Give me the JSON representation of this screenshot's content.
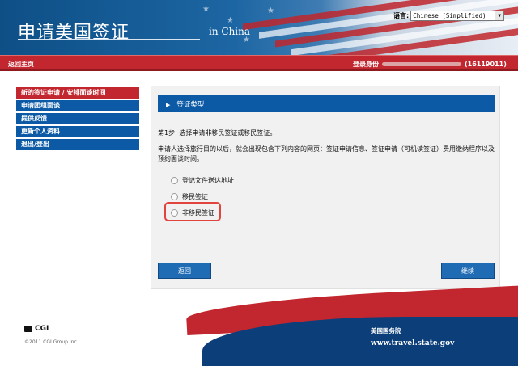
{
  "header": {
    "title": "申请美国签证",
    "subtitle": "in China",
    "language_label": "语言:",
    "language_value": "Chinese (Simplified)"
  },
  "nav": {
    "home": "返回主页",
    "login_label": "登录身份",
    "login_id": "(16119011)"
  },
  "sidebar": {
    "items": [
      {
        "label": "新的签证申请 / 安排面谈时间",
        "active": true
      },
      {
        "label": "申请团组面谈",
        "active": false
      },
      {
        "label": "提供反馈",
        "active": false
      },
      {
        "label": "更新个人资料",
        "active": false
      },
      {
        "label": "退出/登出",
        "active": false
      }
    ]
  },
  "panel": {
    "header": "签证类型",
    "step": "第1步: 选择申请非移民签证或移民签证。",
    "description": "申请人选择旅行目的以后，就会出现包含下列内容的网页：签证申请信息、签证申请（可机读签证）费用缴纳程序以及预约面谈时间。",
    "options": [
      {
        "label": "登记文件送达地址"
      },
      {
        "label": "移民签证"
      },
      {
        "label": "非移民签证"
      }
    ],
    "back_label": "返回",
    "next_label": "继续"
  },
  "footer": {
    "brand": "CGI",
    "copyright": "©2011 CGI Group Inc.",
    "department": "美国国务院",
    "site": "www.travel.state.gov"
  },
  "colors": {
    "primary_blue": "#0c5aa6",
    "primary_red": "#c2262e",
    "highlight": "#e0443d"
  }
}
